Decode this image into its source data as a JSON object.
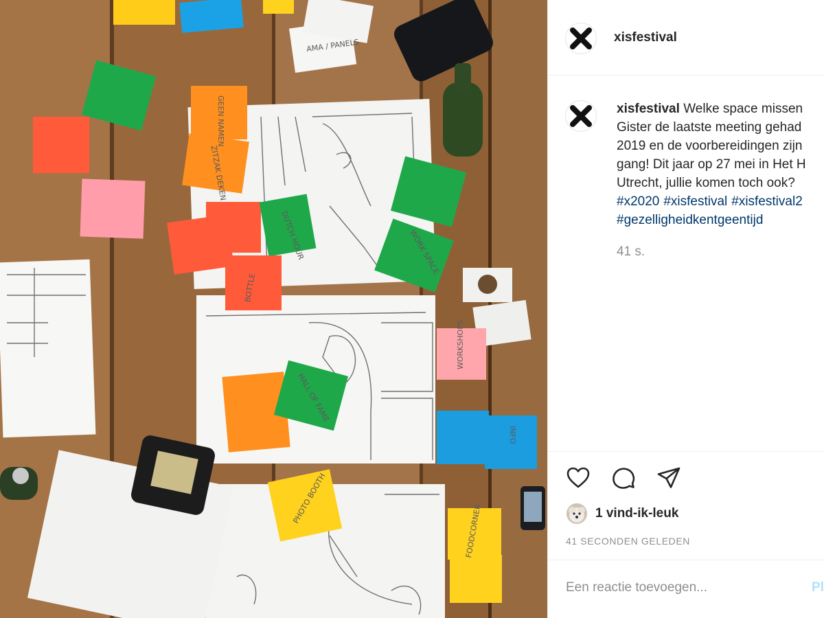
{
  "post": {
    "username": "xisfestival",
    "caption": {
      "username": "xisfestival",
      "lines": [
        "Welke space missen",
        "Gister de laatste meeting gehad",
        "2019 en de voorbereidingen zijn",
        "gang! Dit jaar op 27 mei in Het H",
        "Utrecht, jullie komen toch ook?"
      ],
      "hashtags_line1": [
        "#x2020",
        "#xisfestival",
        "#xisfestival2"
      ],
      "hashtags_line2": [
        "#gezelligheidkentgeentijd"
      ]
    },
    "caption_time": "41 s.",
    "likes_text": "1 vind-ik-leuk",
    "timestamp": "41 SECONDEN GELEDEN",
    "comment_placeholder": "Een reactie toevoegen...",
    "post_button_label": "Pl"
  },
  "icons": {
    "avatar": "x-logo-icon",
    "like": "heart-icon",
    "comment": "comment-bubble-icon",
    "share": "paper-plane-icon",
    "liker": "dog-avatar-icon"
  },
  "photo": {
    "notes": [
      "AMA / PANELS",
      "GEEN NAMEN",
      "ZITZAK DEKEN",
      "DUTCH HOUR",
      "HALL OF FAME",
      "WORKSHOPS",
      "FOODCORNER",
      "BOTTLE",
      "INFO",
      "WORK SPACE",
      "PHOTO BOOTH"
    ]
  },
  "colors": {
    "link": "#00376b",
    "text": "#262626",
    "muted": "#8e8e8e",
    "divider": "#efefef",
    "post_button_disabled": "#b2dffc",
    "table": "#9a6a3e"
  }
}
